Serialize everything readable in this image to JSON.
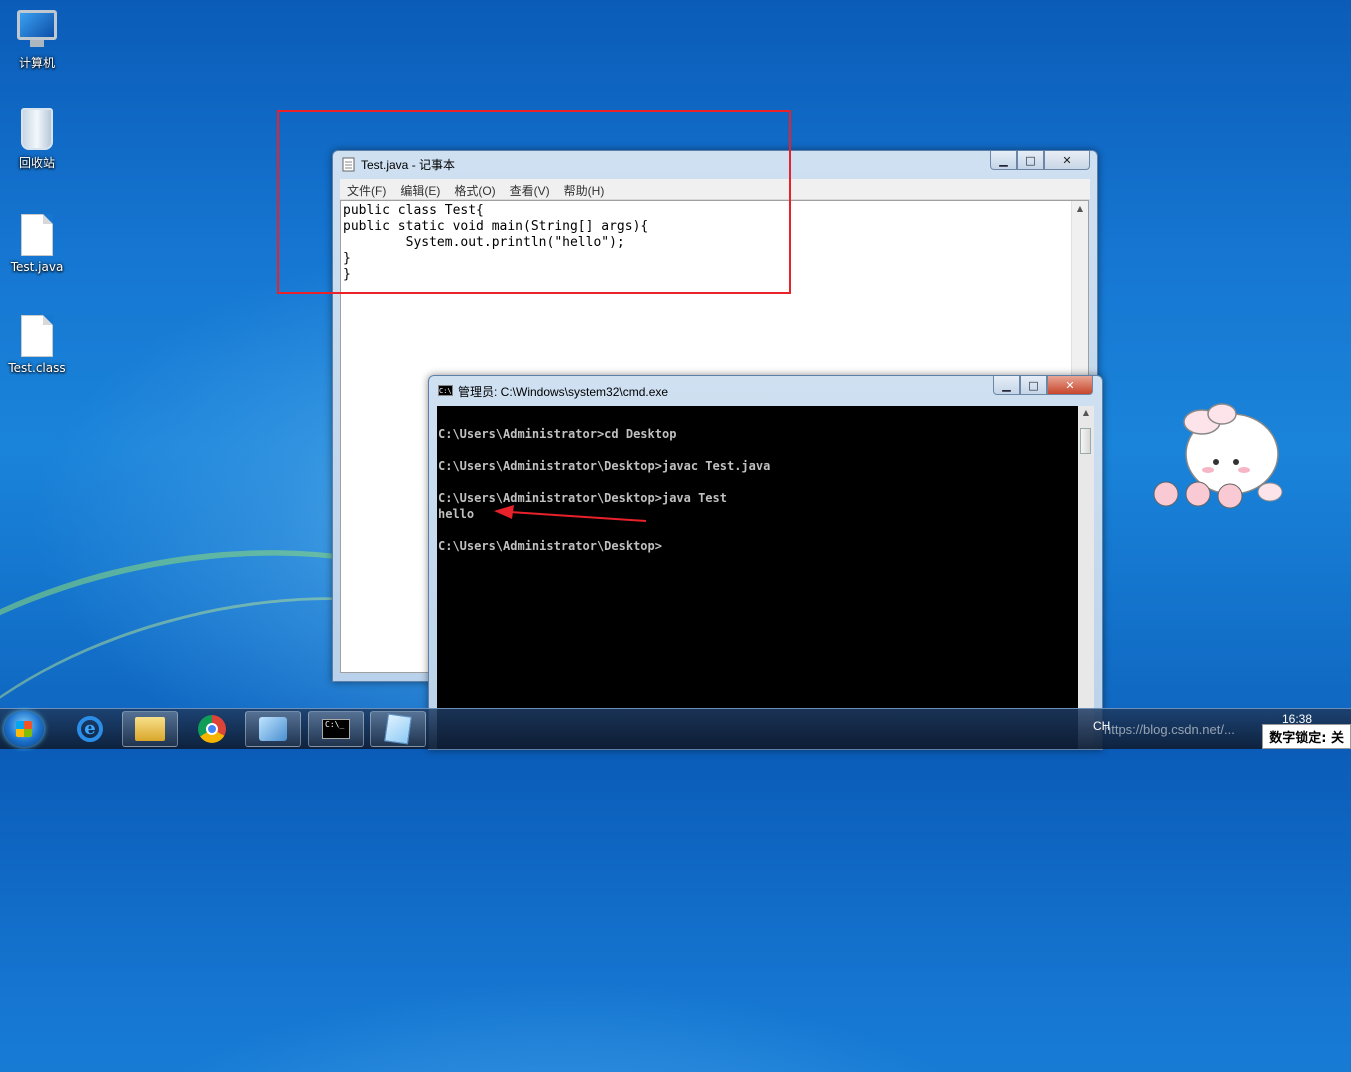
{
  "desktop": {
    "icons": [
      {
        "label": "计算机"
      },
      {
        "label": "回收站"
      },
      {
        "label": "Test.java"
      },
      {
        "label": "Test.class"
      }
    ]
  },
  "notepad": {
    "title": "Test.java - 记事本",
    "menu": [
      "文件(F)",
      "编辑(E)",
      "格式(O)",
      "查看(V)",
      "帮助(H)"
    ],
    "content": "public class Test{\npublic static void main(String[] args){\n        System.out.println(\"hello\");\n}\n}"
  },
  "cmd": {
    "title": "管理员: C:\\Windows\\system32\\cmd.exe",
    "output": "\nC:\\Users\\Administrator>cd Desktop\n\nC:\\Users\\Administrator\\Desktop>javac Test.java\n\nC:\\Users\\Administrator\\Desktop>java Test\nhello\n\nC:\\Users\\Administrator\\Desktop>"
  },
  "taskbar": {
    "ime": "CH",
    "clock": "16:38",
    "watermark": "https://blog.csdn.net/...",
    "numlock": "数字锁定: 关"
  },
  "colors": {
    "annotation": "#e8212b",
    "desktop_bg": "#1677d2"
  }
}
